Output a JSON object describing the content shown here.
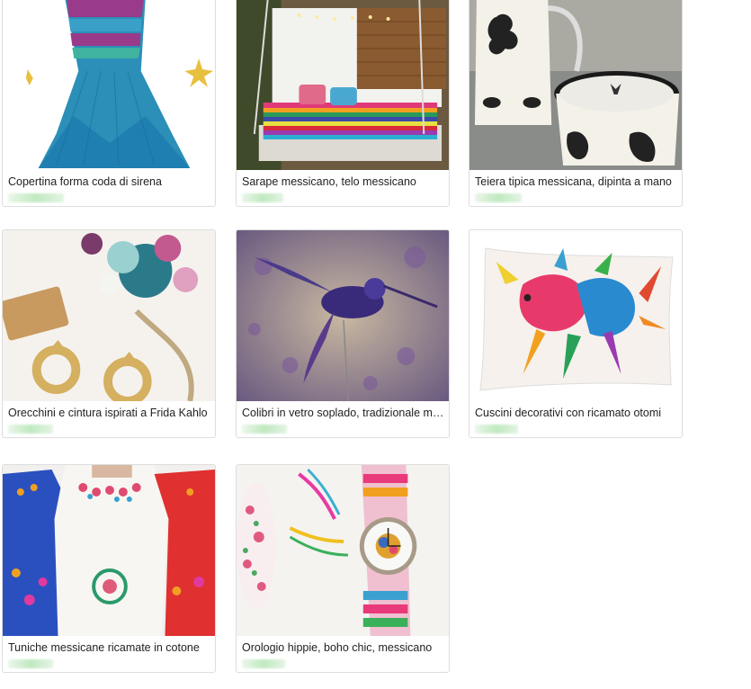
{
  "listings": [
    {
      "title": "Copertina forma coda di sirena",
      "image": "mermaid-blanket-image"
    },
    {
      "title": "Sarape messicano, telo messicano",
      "image": "sarape-bed-image"
    },
    {
      "title": "Teiera tipica messicana, dipinta a mano",
      "image": "teapot-image"
    },
    {
      "title": "Orecchini e cintura ispirati a Frida Kahlo",
      "image": "earrings-image"
    },
    {
      "title": "Colibri in vetro soplado, tradizionale messicano",
      "image": "hummingbird-image"
    },
    {
      "title": "Cuscini decorativi con ricamato otomi",
      "image": "otomi-pillow-image"
    },
    {
      "title": "Tuniche messicane ricamate in cotone",
      "image": "tunics-image"
    },
    {
      "title": "Orologio hippie, boho chic, messicano",
      "image": "watch-image"
    }
  ],
  "colors": {
    "border": "#dddddd",
    "title_text": "#222222",
    "price_blur": "#8cd78c"
  }
}
